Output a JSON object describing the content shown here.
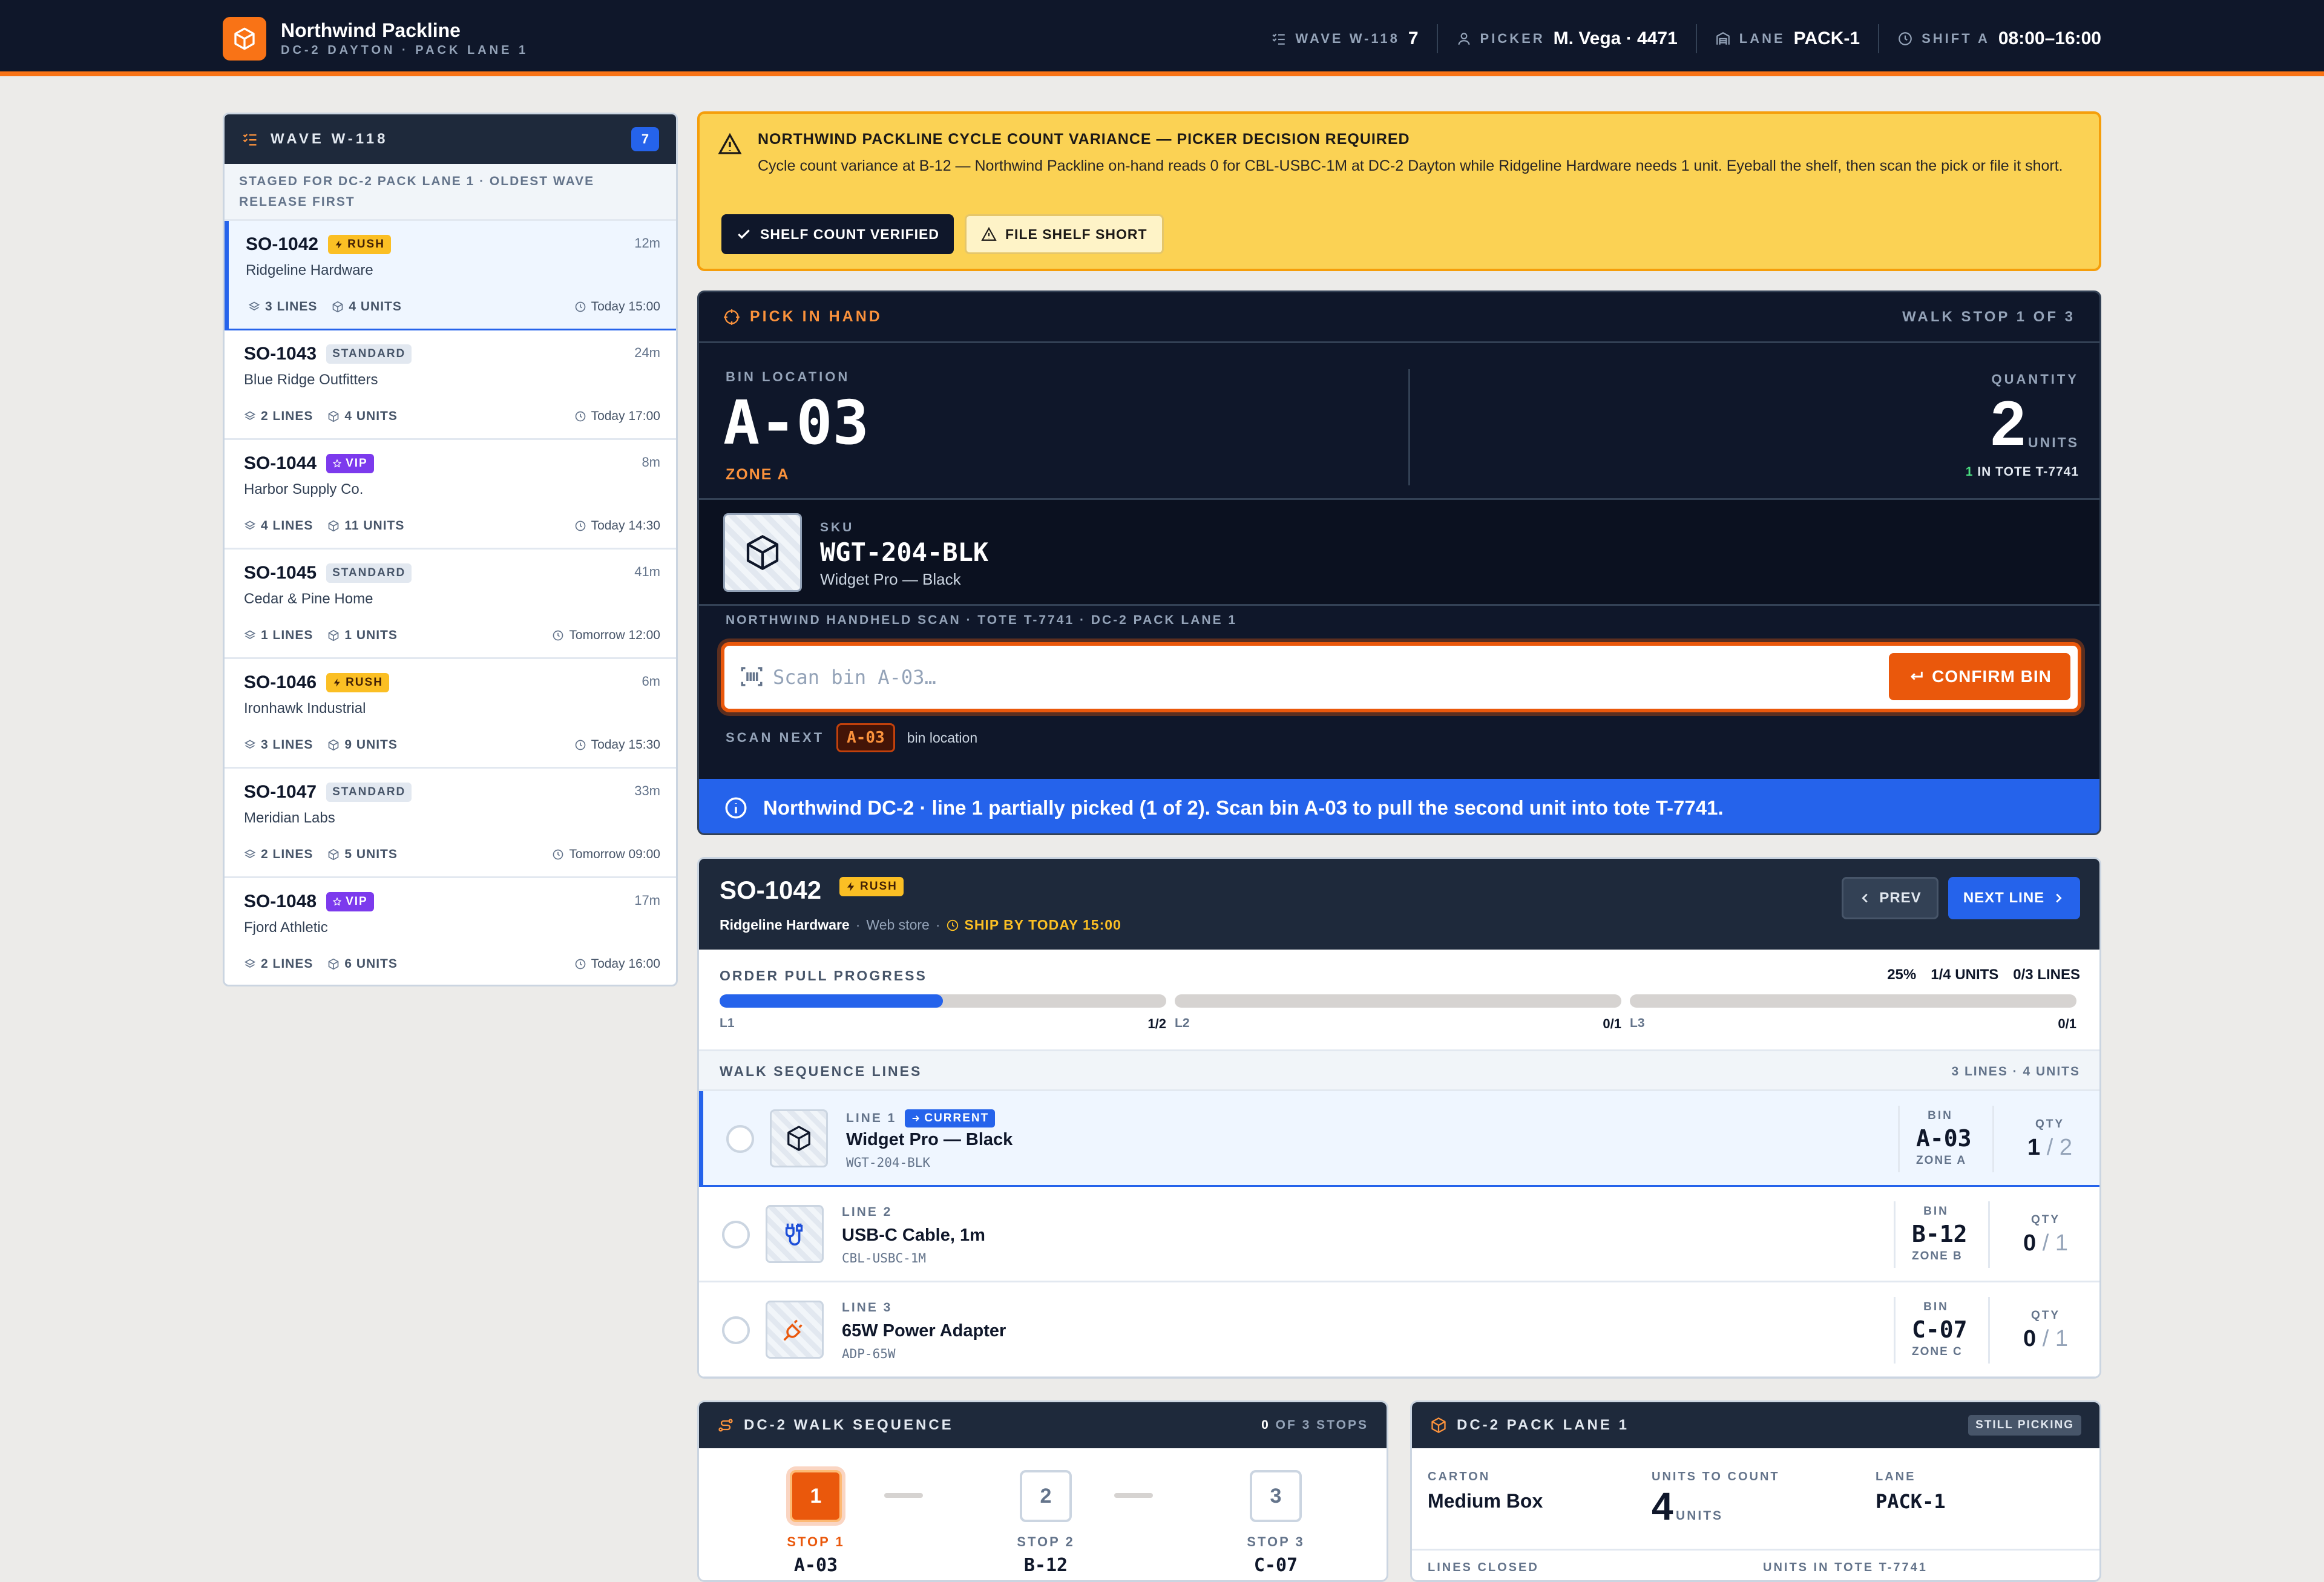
{
  "header": {
    "brand": "Northwind Packline",
    "brand_sub": "DC-2 DAYTON · PACK LANE 1",
    "stats": [
      {
        "label": "WAVE W-118",
        "value": "7",
        "icon": "list-check-icon"
      },
      {
        "label": "PICKER",
        "value": "M. Vega · 4471",
        "icon": "user-icon"
      },
      {
        "label": "LANE",
        "value": "PACK-1",
        "icon": "warehouse-icon"
      },
      {
        "label": "SHIFT A",
        "value": "08:00–16:00",
        "icon": "clock-icon"
      }
    ]
  },
  "wave": {
    "title": "WAVE W-118",
    "count": "7",
    "subtitle": "STAGED FOR DC-2 PACK LANE 1 · OLDEST WAVE RELEASE FIRST",
    "orders": [
      {
        "id": "SO-1042",
        "badge": "RUSH",
        "type": "rush",
        "customer": "Ridgeline Hardware",
        "lines": "3 LINES",
        "units": "4 UNITS",
        "due": "Today 15:00",
        "age": "12m"
      },
      {
        "id": "SO-1043",
        "badge": "STANDARD",
        "type": "std",
        "customer": "Blue Ridge Outfitters",
        "lines": "2 LINES",
        "units": "4 UNITS",
        "due": "Today 17:00",
        "age": "24m"
      },
      {
        "id": "SO-1044",
        "badge": "VIP",
        "type": "vip",
        "customer": "Harbor Supply Co.",
        "lines": "4 LINES",
        "units": "11 UNITS",
        "due": "Today 14:30",
        "age": "8m"
      },
      {
        "id": "SO-1045",
        "badge": "STANDARD",
        "type": "std",
        "customer": "Cedar & Pine Home",
        "lines": "1 LINES",
        "units": "1 UNITS",
        "due": "Tomorrow 12:00",
        "age": "41m"
      },
      {
        "id": "SO-1046",
        "badge": "RUSH",
        "type": "rush",
        "customer": "Ironhawk Industrial",
        "lines": "3 LINES",
        "units": "9 UNITS",
        "due": "Today 15:30",
        "age": "6m"
      },
      {
        "id": "SO-1047",
        "badge": "STANDARD",
        "type": "std",
        "customer": "Meridian Labs",
        "lines": "2 LINES",
        "units": "5 UNITS",
        "due": "Tomorrow 09:00",
        "age": "33m"
      },
      {
        "id": "SO-1048",
        "badge": "VIP",
        "type": "vip",
        "customer": "Fjord Athletic",
        "lines": "2 LINES",
        "units": "6 UNITS",
        "due": "Today 16:00",
        "age": "17m"
      }
    ]
  },
  "alert": {
    "title": "NORTHWIND PACKLINE CYCLE COUNT VARIANCE — PICKER DECISION REQUIRED",
    "message": "Cycle count variance at B-12 — Northwind Packline on-hand reads 0 for CBL-USBC-1M at DC-2 Dayton while Ridgeline Hardware needs 1 unit. Eyeball the shelf, then scan the pick or file it short.",
    "verify_label": "SHELF COUNT VERIFIED",
    "short_label": "FILE SHELF SHORT"
  },
  "pick": {
    "title": "PICK IN HAND",
    "stop": "WALK STOP 1 OF 3",
    "bin_label": "BIN LOCATION",
    "bin": "A-03",
    "zone": "ZONE A",
    "qty_label": "QUANTITY",
    "qty": "2",
    "qty_unit": "UNITS",
    "tote_count": "1",
    "tote_text": "IN TOTE T-7741",
    "sku_label": "SKU",
    "sku": "WGT-204-BLK",
    "sku_name": "Widget Pro — Black",
    "scan_label": "NORTHWIND HANDHELD SCAN · TOTE T-7741 · DC-2 PACK LANE 1",
    "scan_placeholder": "Scan bin A-03…",
    "confirm_label": "CONFIRM BIN",
    "next_label": "SCAN NEXT",
    "next_bin": "A-03",
    "next_sub": "bin location",
    "info": "Northwind DC-2 · line 1 partially picked (1 of 2). Scan bin A-03 to pull the second unit into tote T-7741."
  },
  "order": {
    "id": "SO-1042",
    "badge": "RUSH",
    "customer": "Ridgeline Hardware",
    "channel": "Web store",
    "ship": "SHIP BY TODAY 15:00",
    "prev_label": "PREV",
    "next_label": "NEXT LINE",
    "progress_label": "ORDER PULL PROGRESS",
    "progress_pct": "25%",
    "progress_units": "1/4 UNITS",
    "progress_lines": "0/3 LINES",
    "segments": [
      {
        "label": "L1",
        "done": 1,
        "total": 2,
        "count": "1/2"
      },
      {
        "label": "L2",
        "done": 0,
        "total": 1,
        "count": "0/1"
      },
      {
        "label": "L3",
        "done": 0,
        "total": 1,
        "count": "0/1"
      }
    ],
    "lines_label": "WALK SEQUENCE LINES",
    "lines_summary": "3 LINES · 4 UNITS",
    "bin_col": "BIN",
    "qty_col": "QTY",
    "current_label": "CURRENT",
    "lines": [
      {
        "n": "LINE 1",
        "name": "Widget Pro — Black",
        "sku": "WGT-204-BLK",
        "bin": "A-03",
        "zone": "ZONE A",
        "picked": "1",
        "qty": "2",
        "icon": "box-icon"
      },
      {
        "n": "LINE 2",
        "name": "USB-C Cable, 1m",
        "sku": "CBL-USBC-1M",
        "bin": "B-12",
        "zone": "ZONE B",
        "picked": "0",
        "qty": "1",
        "icon": "cable-icon"
      },
      {
        "n": "LINE 3",
        "name": "65W Power Adapter",
        "sku": "ADP-65W",
        "bin": "C-07",
        "zone": "ZONE C",
        "picked": "0",
        "qty": "1",
        "icon": "plug-icon"
      }
    ]
  },
  "walk": {
    "title": "DC-2 WALK SEQUENCE",
    "done": "0",
    "of": "OF 3 STOPS",
    "stops": [
      {
        "n": "1",
        "label": "STOP 1",
        "bin": "A-03"
      },
      {
        "n": "2",
        "label": "STOP 2",
        "bin": "B-12"
      },
      {
        "n": "3",
        "label": "STOP 3",
        "bin": "C-07"
      }
    ]
  },
  "pack": {
    "title": "DC-2 PACK LANE 1",
    "status": "STILL PICKING",
    "carton_label": "CARTON",
    "carton": "Medium Box",
    "units_label": "UNITS TO COUNT",
    "units": "4",
    "units_unit": "UNITS",
    "lane_label": "LANE",
    "lane": "PACK-1",
    "lines_closed_label": "LINES CLOSED",
    "units_tote_label": "UNITS IN TOTE T-7741"
  },
  "colors": {
    "accent": "#f97316",
    "primary": "#2563eb",
    "dark": "#0f172a",
    "alert": "#fbd254"
  }
}
